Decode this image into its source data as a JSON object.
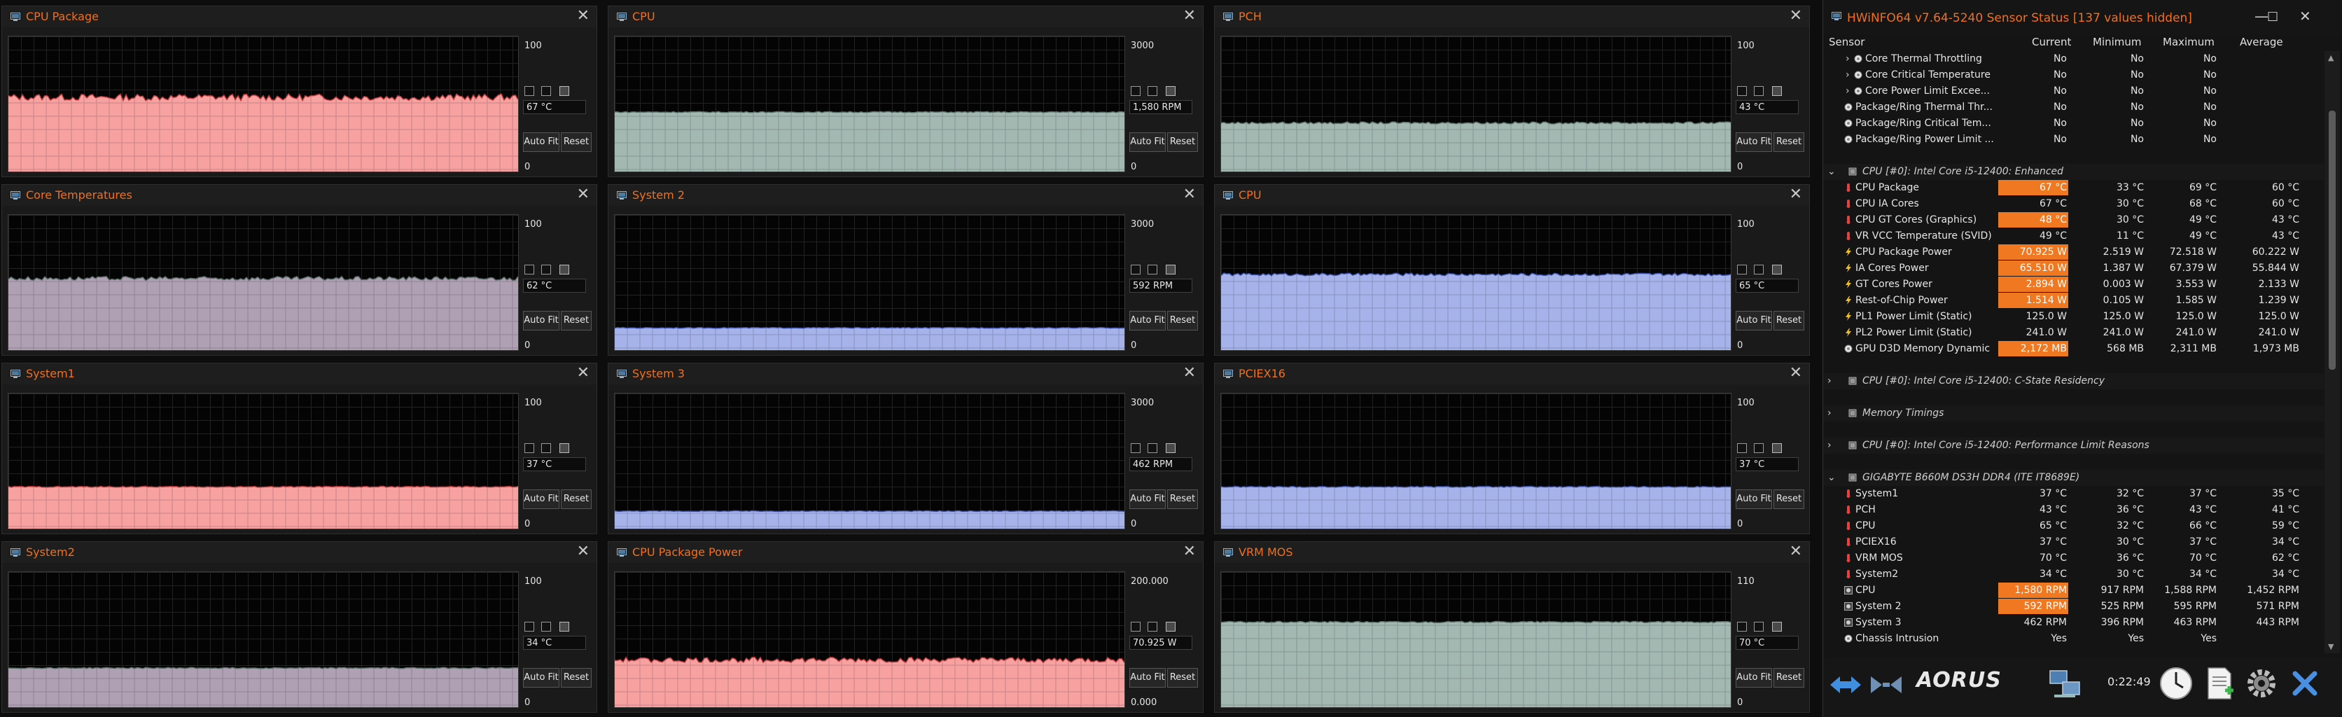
{
  "graphs": [
    {
      "id": "g1",
      "title": "CPU Package",
      "max": "100",
      "min": "0",
      "value": "67 °C",
      "color": "#f7a1a1",
      "level": 0.55,
      "jitter": 0.025
    },
    {
      "id": "g2",
      "title": "CPU",
      "max": "3000",
      "min": "0",
      "value": "1,580 RPM",
      "color": "#a4b8b2",
      "level": 0.44,
      "jitter": 0.004
    },
    {
      "id": "g3",
      "title": "PCH",
      "max": "100",
      "min": "0",
      "value": "43 °C",
      "color": "#a4b8b2",
      "level": 0.36,
      "jitter": 0.008
    },
    {
      "id": "g4",
      "title": "Core Temperatures",
      "max": "100",
      "min": "0",
      "value": "62 °C",
      "color": "#b0a0b4",
      "level": 0.53,
      "jitter": 0.015
    },
    {
      "id": "g5",
      "title": "System 2",
      "max": "3000",
      "min": "0",
      "value": "592 RPM",
      "color": "#a5b3ea",
      "level": 0.165,
      "jitter": 0.003
    },
    {
      "id": "g6",
      "title": "CPU",
      "max": "100",
      "min": "0",
      "value": "65 °C",
      "color": "#a5b3ea",
      "level": 0.56,
      "jitter": 0.01
    },
    {
      "id": "g7",
      "title": "System1",
      "max": "100",
      "min": "0",
      "value": "37 °C",
      "color": "#f7a1a1",
      "level": 0.31,
      "jitter": 0.004
    },
    {
      "id": "g8",
      "title": "System 3",
      "max": "3000",
      "min": "0",
      "value": "462 RPM",
      "color": "#a5b3ea",
      "level": 0.13,
      "jitter": 0.003
    },
    {
      "id": "g9",
      "title": "PCIEX16",
      "max": "100",
      "min": "0",
      "value": "37 °C",
      "color": "#a5b3ea",
      "level": 0.31,
      "jitter": 0.004
    },
    {
      "id": "g10",
      "title": "System2",
      "max": "100",
      "min": "0",
      "value": "34 °C",
      "color": "#b0a0b4",
      "level": 0.29,
      "jitter": 0.004
    },
    {
      "id": "g11",
      "title": "CPU Package Power",
      "max": "200.000",
      "min": "0.000",
      "value": "70.925 W",
      "color": "#f7a1a1",
      "level": 0.35,
      "jitter": 0.02
    },
    {
      "id": "g12",
      "title": "VRM MOS",
      "max": "110",
      "min": "0",
      "value": "70 °C",
      "color": "#a4b8b2",
      "level": 0.63,
      "jitter": 0.005
    }
  ],
  "controls": {
    "auto_fit": "Auto Fit",
    "reset": "Reset"
  },
  "hwinfo": {
    "title": "HWiNFO64 v7.64-5240 Sensor Status [137 values hidden]",
    "columns": {
      "sensor": "Sensor",
      "current": "Current",
      "minimum": "Minimum",
      "maximum": "Maximum",
      "average": "Average"
    },
    "clock": "0:22:49",
    "brand": "AORUS",
    "rows": [
      {
        "type": "item",
        "indent": 2,
        "icon": "circle",
        "name": "Core Thermal Throttling",
        "cur": "No",
        "min": "No",
        "max": "No",
        "avg": ""
      },
      {
        "type": "item",
        "indent": 2,
        "icon": "circle",
        "name": "Core Critical Temperature",
        "cur": "No",
        "min": "No",
        "max": "No",
        "avg": ""
      },
      {
        "type": "item",
        "indent": 2,
        "icon": "circle",
        "name": "Core Power Limit Excee...",
        "cur": "No",
        "min": "No",
        "max": "No",
        "avg": ""
      },
      {
        "type": "item",
        "indent": 1,
        "icon": "circle",
        "name": "Package/Ring Thermal Thr...",
        "cur": "No",
        "min": "No",
        "max": "No",
        "avg": ""
      },
      {
        "type": "item",
        "indent": 1,
        "icon": "circle",
        "name": "Package/Ring Critical Tem...",
        "cur": "No",
        "min": "No",
        "max": "No",
        "avg": ""
      },
      {
        "type": "item",
        "indent": 1,
        "icon": "circle",
        "name": "Package/Ring Power Limit ...",
        "cur": "No",
        "min": "No",
        "max": "No",
        "avg": ""
      },
      {
        "type": "blank"
      },
      {
        "type": "group",
        "expanded": true,
        "name": "CPU [#0]: Intel Core i5-12400: Enhanced"
      },
      {
        "type": "item",
        "indent": 1,
        "icon": "temp",
        "name": "CPU Package",
        "cur": "67 °C",
        "min": "33 °C",
        "max": "69 °C",
        "avg": "60 °C",
        "hl": true
      },
      {
        "type": "item",
        "indent": 1,
        "icon": "temp",
        "name": "CPU IA Cores",
        "cur": "67 °C",
        "min": "30 °C",
        "max": "68 °C",
        "avg": "60 °C"
      },
      {
        "type": "item",
        "indent": 1,
        "icon": "temp",
        "name": "CPU GT Cores (Graphics)",
        "cur": "48 °C",
        "min": "30 °C",
        "max": "49 °C",
        "avg": "43 °C",
        "hl": true
      },
      {
        "type": "item",
        "indent": 1,
        "icon": "temp",
        "name": "VR VCC Temperature (SVID)",
        "cur": "49 °C",
        "min": "11 °C",
        "max": "49 °C",
        "avg": "43 °C"
      },
      {
        "type": "item",
        "indent": 1,
        "icon": "bolt",
        "name": "CPU Package Power",
        "cur": "70.925 W",
        "min": "2.519 W",
        "max": "72.518 W",
        "avg": "60.222 W",
        "hl": true
      },
      {
        "type": "item",
        "indent": 1,
        "icon": "bolt",
        "name": "IA Cores Power",
        "cur": "65.510 W",
        "min": "1.387 W",
        "max": "67.379 W",
        "avg": "55.844 W",
        "hl": true
      },
      {
        "type": "item",
        "indent": 1,
        "icon": "bolt",
        "name": "GT Cores Power",
        "cur": "2.894 W",
        "min": "0.003 W",
        "max": "3.553 W",
        "avg": "2.133 W",
        "hl": true
      },
      {
        "type": "item",
        "indent": 1,
        "icon": "bolt",
        "name": "Rest-of-Chip Power",
        "cur": "1.514 W",
        "min": "0.105 W",
        "max": "1.585 W",
        "avg": "1.239 W",
        "hl": true
      },
      {
        "type": "item",
        "indent": 1,
        "icon": "bolt",
        "name": "PL1 Power Limit (Static)",
        "cur": "125.0 W",
        "min": "125.0 W",
        "max": "125.0 W",
        "avg": "125.0 W"
      },
      {
        "type": "item",
        "indent": 1,
        "icon": "bolt",
        "name": "PL2 Power Limit (Static)",
        "cur": "241.0 W",
        "min": "241.0 W",
        "max": "241.0 W",
        "avg": "241.0 W"
      },
      {
        "type": "item",
        "indent": 1,
        "icon": "circle",
        "name": "GPU D3D Memory Dynamic",
        "cur": "2,172 MB",
        "min": "568 MB",
        "max": "2,311 MB",
        "avg": "1,973 MB",
        "hl": true
      },
      {
        "type": "blank"
      },
      {
        "type": "group",
        "expanded": false,
        "name": "CPU [#0]: Intel Core i5-12400: C-State Residency"
      },
      {
        "type": "blank"
      },
      {
        "type": "group",
        "expanded": false,
        "name": "Memory Timings"
      },
      {
        "type": "blank"
      },
      {
        "type": "group",
        "expanded": false,
        "name": "CPU [#0]: Intel Core i5-12400: Performance Limit Reasons"
      },
      {
        "type": "blank"
      },
      {
        "type": "group",
        "expanded": true,
        "name": "GIGABYTE B660M DS3H DDR4 (ITE IT8689E)"
      },
      {
        "type": "item",
        "indent": 1,
        "icon": "temp",
        "name": "System1",
        "cur": "37 °C",
        "min": "32 °C",
        "max": "37 °C",
        "avg": "35 °C"
      },
      {
        "type": "item",
        "indent": 1,
        "icon": "temp",
        "name": "PCH",
        "cur": "43 °C",
        "min": "36 °C",
        "max": "43 °C",
        "avg": "41 °C"
      },
      {
        "type": "item",
        "indent": 1,
        "icon": "temp",
        "name": "CPU",
        "cur": "65 °C",
        "min": "32 °C",
        "max": "66 °C",
        "avg": "59 °C"
      },
      {
        "type": "item",
        "indent": 1,
        "icon": "temp",
        "name": "PCIEX16",
        "cur": "37 °C",
        "min": "30 °C",
        "max": "37 °C",
        "avg": "34 °C"
      },
      {
        "type": "item",
        "indent": 1,
        "icon": "temp",
        "name": "VRM MOS",
        "cur": "70 °C",
        "min": "36 °C",
        "max": "70 °C",
        "avg": "62 °C"
      },
      {
        "type": "item",
        "indent": 1,
        "icon": "temp",
        "name": "System2",
        "cur": "34 °C",
        "min": "30 °C",
        "max": "34 °C",
        "avg": "34 °C"
      },
      {
        "type": "item",
        "indent": 1,
        "icon": "fan",
        "name": "CPU",
        "cur": "1,580 RPM",
        "min": "917 RPM",
        "max": "1,588 RPM",
        "avg": "1,452 RPM",
        "hl": true
      },
      {
        "type": "item",
        "indent": 1,
        "icon": "fan",
        "name": "System 2",
        "cur": "592 RPM",
        "min": "525 RPM",
        "max": "595 RPM",
        "avg": "571 RPM",
        "hl": true
      },
      {
        "type": "item",
        "indent": 1,
        "icon": "fan",
        "name": "System 3",
        "cur": "462 RPM",
        "min": "396 RPM",
        "max": "463 RPM",
        "avg": "443 RPM"
      },
      {
        "type": "item",
        "indent": 1,
        "icon": "circle",
        "name": "Chassis Intrusion",
        "cur": "Yes",
        "min": "Yes",
        "max": "Yes",
        "avg": ""
      }
    ]
  },
  "colors": {
    "accent": "#f07020",
    "highlight": "#f07820",
    "window_bg": "#1a1a1a"
  }
}
